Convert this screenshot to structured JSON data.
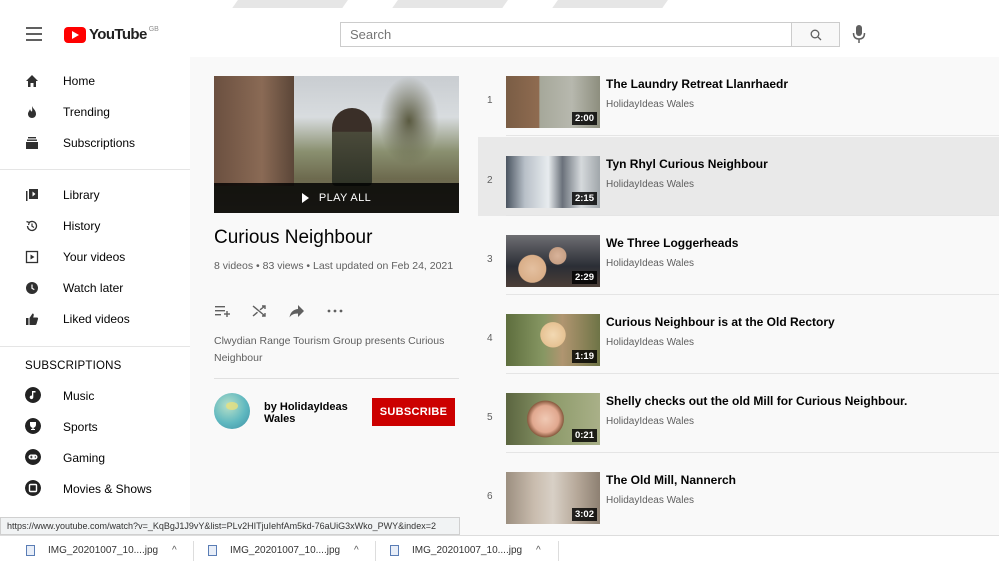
{
  "header": {
    "logo_text": "YouTube",
    "logo_country": "GB",
    "search_placeholder": "Search"
  },
  "sidebar": {
    "main": [
      {
        "label": "Home",
        "icon": "home-icon"
      },
      {
        "label": "Trending",
        "icon": "flame-icon"
      },
      {
        "label": "Subscriptions",
        "icon": "subscriptions-icon"
      }
    ],
    "library": [
      {
        "label": "Library",
        "icon": "library-icon"
      },
      {
        "label": "History",
        "icon": "history-icon"
      },
      {
        "label": "Your videos",
        "icon": "your-videos-icon"
      },
      {
        "label": "Watch later",
        "icon": "clock-icon"
      },
      {
        "label": "Liked videos",
        "icon": "thumbs-up-icon"
      }
    ],
    "subscriptions_heading": "SUBSCRIPTIONS",
    "subscriptions": [
      {
        "label": "Music"
      },
      {
        "label": "Sports"
      },
      {
        "label": "Gaming"
      },
      {
        "label": "Movies & Shows"
      }
    ]
  },
  "playlist": {
    "play_all": "PLAY ALL",
    "title": "Curious Neighbour",
    "stats": "8 videos • 83 views • Last updated on Feb 24, 2021",
    "description": "Clwydian Range Tourism Group presents Curious Neighbour",
    "owner_by": "by HolidayIdeas",
    "owner_name": "Wales",
    "subscribe_label": "SUBSCRIBE"
  },
  "videos": [
    {
      "index": "1",
      "title": "The Laundry Retreat Llanrhaedr",
      "channel": "HolidayIdeas Wales",
      "duration": "2:00"
    },
    {
      "index": "2",
      "title": "Tyn Rhyl Curious Neighbour",
      "channel": "HolidayIdeas Wales",
      "duration": "2:15"
    },
    {
      "index": "3",
      "title": "We Three Loggerheads",
      "channel": "HolidayIdeas Wales",
      "duration": "2:29"
    },
    {
      "index": "4",
      "title": "Curious Neighbour is at the Old Rectory",
      "channel": "HolidayIdeas Wales",
      "duration": "1:19"
    },
    {
      "index": "5",
      "title": "Shelly checks out the old Mill for Curious Neighbour.",
      "channel": "HolidayIdeas Wales",
      "duration": "0:21"
    },
    {
      "index": "6",
      "title": "The Old Mill, Nannerch",
      "channel": "HolidayIdeas Wales",
      "duration": "3:02"
    }
  ],
  "status_url": "https://www.youtube.com/watch?v=_KqBgJ1J9vY&list=PLv2HITjuIehfAm5kd-76aUiG3xWko_PWY&index=2",
  "downloads": [
    {
      "name": "IMG_20201007_10....jpg"
    },
    {
      "name": "IMG_20201007_10....jpg"
    },
    {
      "name": "IMG_20201007_10....jpg"
    }
  ],
  "colors": {
    "brand_red": "#ff0000",
    "subscribe_red": "#cc0000",
    "selected_row": "#e9e9e9"
  }
}
